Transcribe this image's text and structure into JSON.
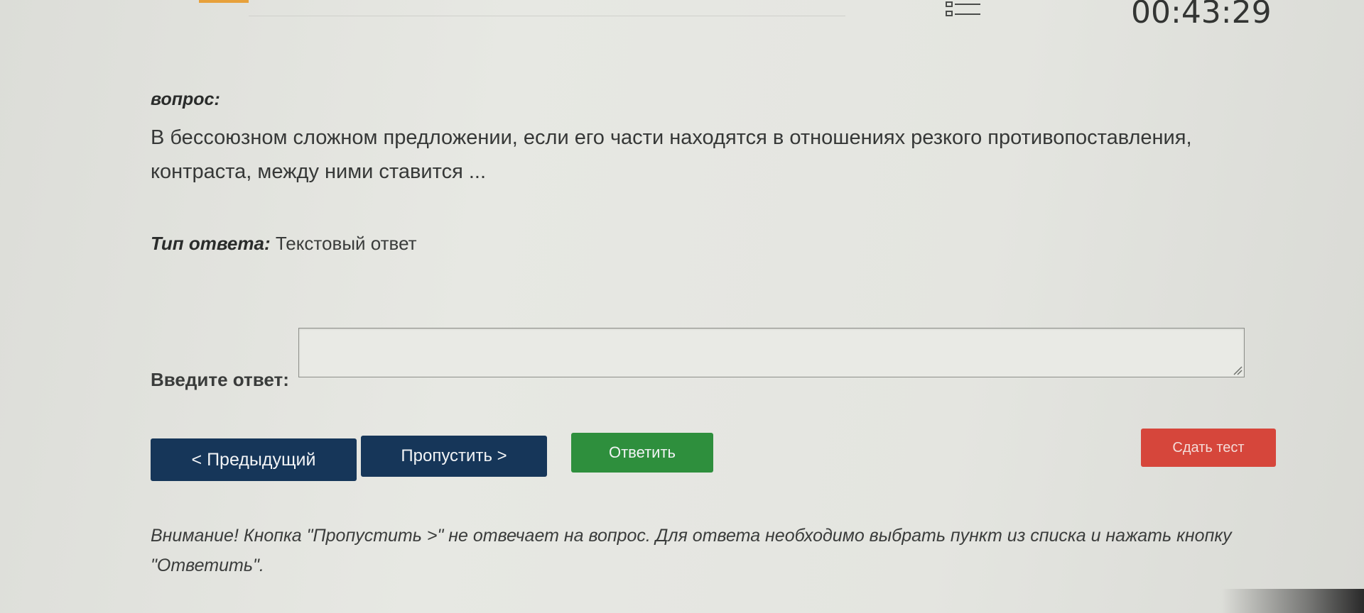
{
  "header": {
    "timer": "00:43:29",
    "question_list_icon": "list-icon"
  },
  "question": {
    "label": "вопрос:",
    "text": "В бессоюзном сложном предложении, если его части находятся в отношениях резкого противопоставления, контраста, между ними ставится ..."
  },
  "answer_type": {
    "label": "Тип ответа:",
    "value": "Текстовый ответ"
  },
  "answer_input": {
    "label": "Введите ответ:",
    "value": "",
    "placeholder": ""
  },
  "buttons": {
    "previous": "< Предыдущий",
    "skip": "Пропустить >",
    "answer": "Ответить",
    "submit_test": "Сдать тест"
  },
  "notice": "Внимание! Кнопка \"Пропустить >\" не отвечает на вопрос. Для ответа необходимо выбрать пункт из списка и нажать кнопку \"Ответить\".",
  "colors": {
    "nav_button": "#163659",
    "answer_button": "#2e8f3d",
    "submit_button": "#d6463b",
    "accent": "#e7a13b"
  }
}
